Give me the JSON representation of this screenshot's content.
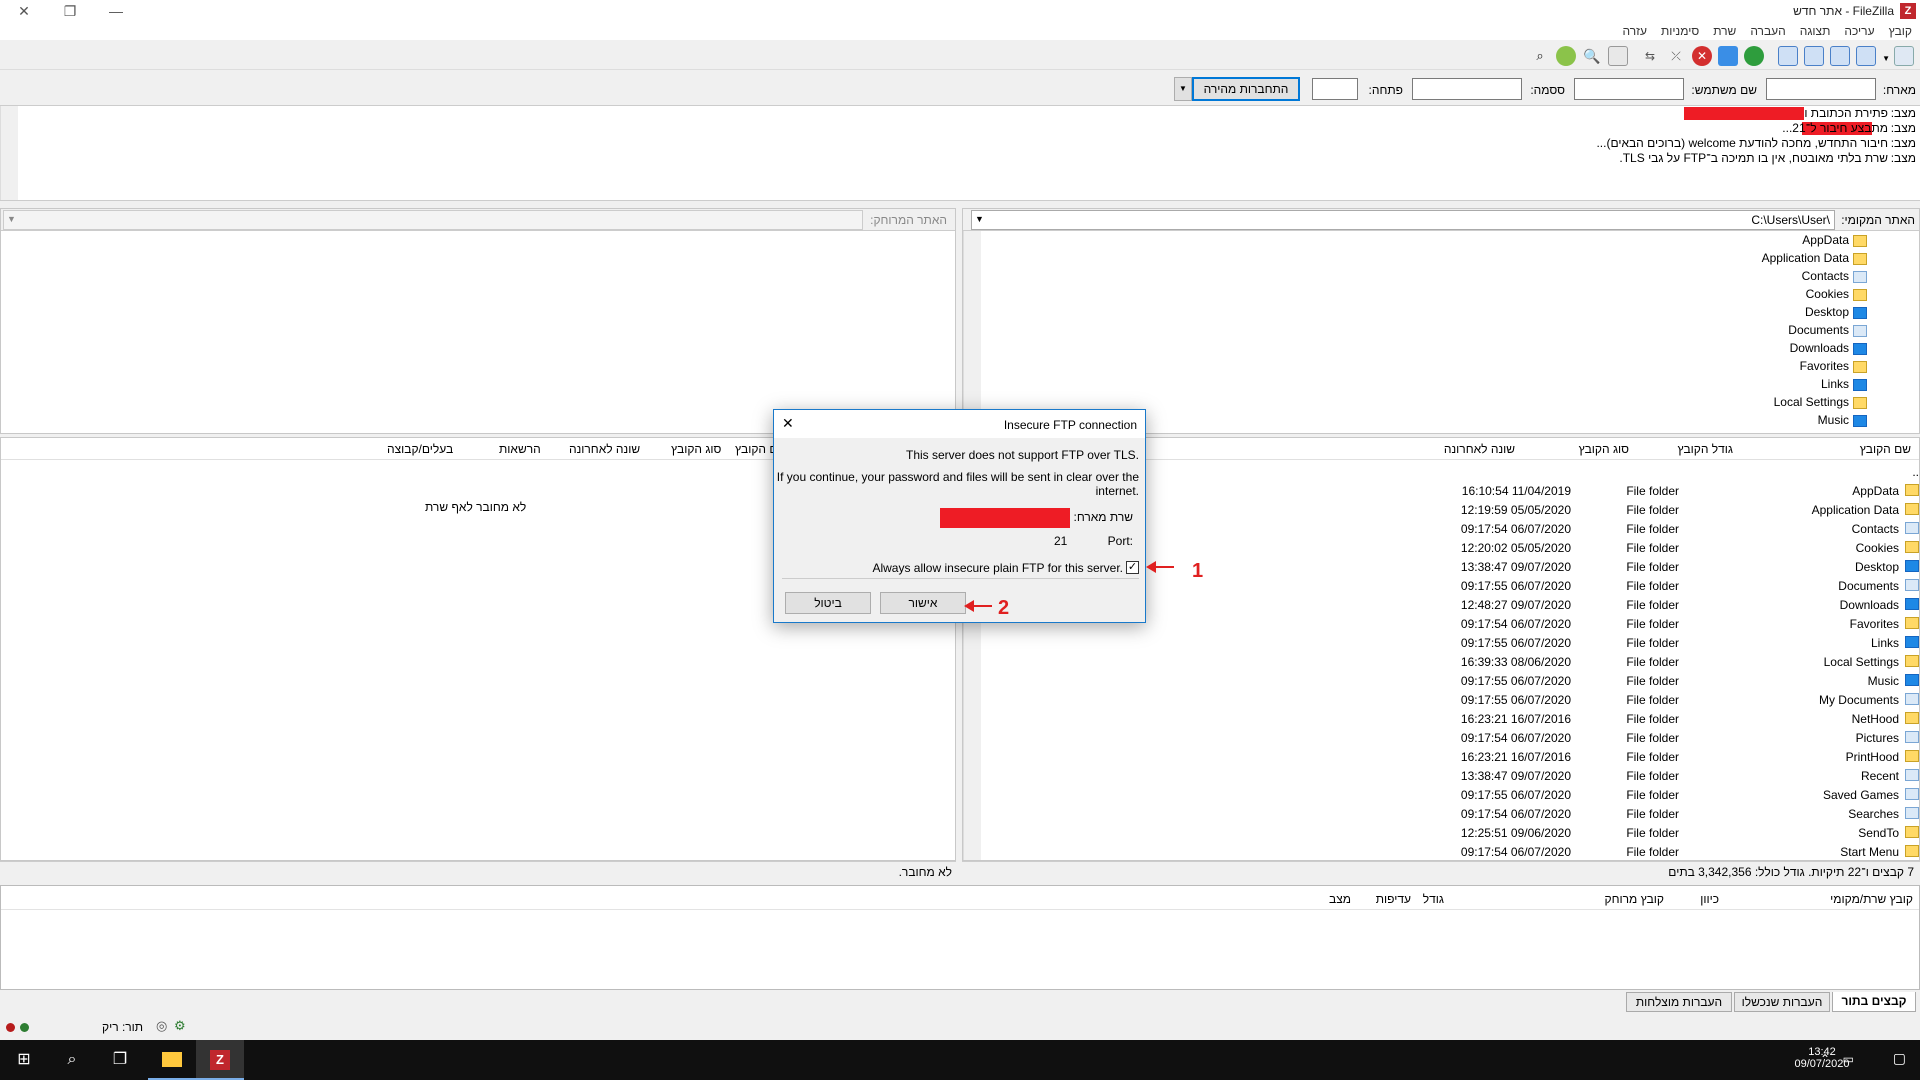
{
  "window": {
    "title": "אתר חדש - FileZilla",
    "logo_letter": "Z"
  },
  "menu": [
    "קובץ",
    "עריכה",
    "תצוגה",
    "העברה",
    "שרת",
    "סימניות",
    "עזרה"
  ],
  "quickconnect": {
    "host_label": "מארח:",
    "user_label": "שם משתמש:",
    "pass_label": "ססמה:",
    "port_label": "פתחה:",
    "button_label": "התחברות מהירה"
  },
  "log": [
    {
      "label": "מצב:",
      "text": "פתירת הכתובת ו"
    },
    {
      "label": "מצב:",
      "text": "מתבצע חיבור ל־21..."
    },
    {
      "label": "מצב:",
      "text": "חיבור התחדש, מחכה להודעת welcome (ברוכים הבאים)..."
    },
    {
      "label": "מצב:",
      "text": "שרת בלתי מאובטח, אין בו תמיכה ב־FTP על גבי TLS."
    }
  ],
  "local": {
    "site_label": "האתר המקומי:",
    "path": "C:\\Users\\User\\",
    "tree": [
      {
        "name": "AppData",
        "type": "folder"
      },
      {
        "name": "Application Data",
        "type": "folder"
      },
      {
        "name": "Contacts",
        "type": "special"
      },
      {
        "name": "Cookies",
        "type": "folder"
      },
      {
        "name": "Desktop",
        "type": "blue"
      },
      {
        "name": "Documents",
        "type": "special"
      },
      {
        "name": "Downloads",
        "type": "blue"
      },
      {
        "name": "Favorites",
        "type": "folder"
      },
      {
        "name": "Links",
        "type": "blue"
      },
      {
        "name": "Local Settings",
        "type": "folder"
      },
      {
        "name": "Music",
        "type": "blue"
      }
    ],
    "columns": {
      "name": "שם הקובץ",
      "size": "גודל הקובץ",
      "type": "סוג הקובץ",
      "modified": "שונה לאחרונה"
    },
    "files": [
      {
        "name": "..",
        "type": "",
        "modified": ""
      },
      {
        "name": "AppData",
        "type": "File folder",
        "modified": "16:10:54 11/04/2019"
      },
      {
        "name": "Application Data",
        "type": "File folder",
        "modified": "12:19:59 05/05/2020"
      },
      {
        "name": "Contacts",
        "type": "File folder",
        "modified": "09:17:54 06/07/2020"
      },
      {
        "name": "Cookies",
        "type": "File folder",
        "modified": "12:20:02 05/05/2020"
      },
      {
        "name": "Desktop",
        "type": "File folder",
        "modified": "13:38:47 09/07/2020"
      },
      {
        "name": "Documents",
        "type": "File folder",
        "modified": "09:17:55 06/07/2020"
      },
      {
        "name": "Downloads",
        "type": "File folder",
        "modified": "12:48:27 09/07/2020"
      },
      {
        "name": "Favorites",
        "type": "File folder",
        "modified": "09:17:54 06/07/2020"
      },
      {
        "name": "Links",
        "type": "File folder",
        "modified": "09:17:55 06/07/2020"
      },
      {
        "name": "Local Settings",
        "type": "File folder",
        "modified": "16:39:33 08/06/2020"
      },
      {
        "name": "Music",
        "type": "File folder",
        "modified": "09:17:55 06/07/2020"
      },
      {
        "name": "My Documents",
        "type": "File folder",
        "modified": "09:17:55 06/07/2020"
      },
      {
        "name": "NetHood",
        "type": "File folder",
        "modified": "16:23:21 16/07/2016"
      },
      {
        "name": "Pictures",
        "type": "File folder",
        "modified": "09:17:54 06/07/2020"
      },
      {
        "name": "PrintHood",
        "type": "File folder",
        "modified": "16:23:21 16/07/2016"
      },
      {
        "name": "Recent",
        "type": "File folder",
        "modified": "13:38:47 09/07/2020"
      },
      {
        "name": "Saved Games",
        "type": "File folder",
        "modified": "09:17:55 06/07/2020"
      },
      {
        "name": "Searches",
        "type": "File folder",
        "modified": "09:17:54 06/07/2020"
      },
      {
        "name": "SendTo",
        "type": "File folder",
        "modified": "12:25:51 09/06/2020"
      },
      {
        "name": "Start Menu",
        "type": "File folder",
        "modified": "09:17:54 06/07/2020"
      }
    ],
    "status": "7 קבצים ו־22 תיקיות. גודל כולל: 3,342,356 בתים"
  },
  "remote": {
    "site_label": "האתר המרוחק:",
    "columns": {
      "name": "שם הקובץ",
      "type": "סוג הקובץ",
      "modified": "שונה לאחרונה",
      "perms": "הרשאות",
      "owner": "בעלים/קבוצה"
    },
    "empty_msg": "לא מחובר לאף שרת",
    "status": "לא מחובר."
  },
  "queue": {
    "columns": {
      "local": "קובץ שרת/מקומי",
      "direction": "כיוון",
      "remote": "קובץ מרוחק",
      "size": "גודל",
      "priority": "עדיפות",
      "state": "מצב"
    },
    "tabs": [
      "קבצים בתור",
      "העברות שנכשלו",
      "העברות מוצלחות"
    ]
  },
  "app_status": {
    "queue": "תור: ריק"
  },
  "taskbar": {
    "time": "13:42",
    "date": "09/07/2020"
  },
  "dialog": {
    "title": "Insecure FTP connection",
    "line1": "This server does not support FTP over TLS.",
    "line2a": "If you continue, your password and files will be sent in clear over the",
    "line2b": "internet.",
    "host_label": "שרת מארח:",
    "port_label": "Port:",
    "port_value": "21",
    "checkbox_label": "Always allow insecure plain FTP for this server.",
    "ok_label": "אישור",
    "cancel_label": "ביטול",
    "annotation1": "1",
    "annotation2": "2"
  },
  "colors": {
    "accent": "#0078d7",
    "redaction": "#ee1c25",
    "annotation": "#e02020"
  }
}
